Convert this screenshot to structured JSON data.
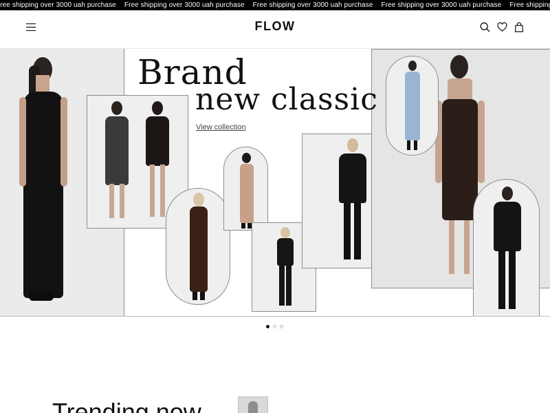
{
  "announcement": {
    "items": [
      "Free shipping over 3000 uah purchase",
      "Free shipping over 3000 uah purchase",
      "Free shipping over 3000 uah purchase",
      "Free shipping over 3000 uah purchase",
      "Free shipping over 3000 uah purchase"
    ]
  },
  "header": {
    "logo": "FLOW",
    "menu_icon": "hamburger-menu-icon",
    "search_icon": "search-icon",
    "wishlist_icon": "heart-icon",
    "cart_icon": "shopping-bag-icon"
  },
  "hero": {
    "headline_line1": "Brand",
    "headline_line2": "new classic",
    "cta": "View collection"
  },
  "carousel": {
    "slides": 3,
    "active_slide": 1
  },
  "trending": {
    "title": "Trending now"
  },
  "colors": {
    "background": "#ffffff",
    "marquee_bg": "#000000",
    "text": "#111111",
    "photo_bg": "#e6e6e6"
  }
}
